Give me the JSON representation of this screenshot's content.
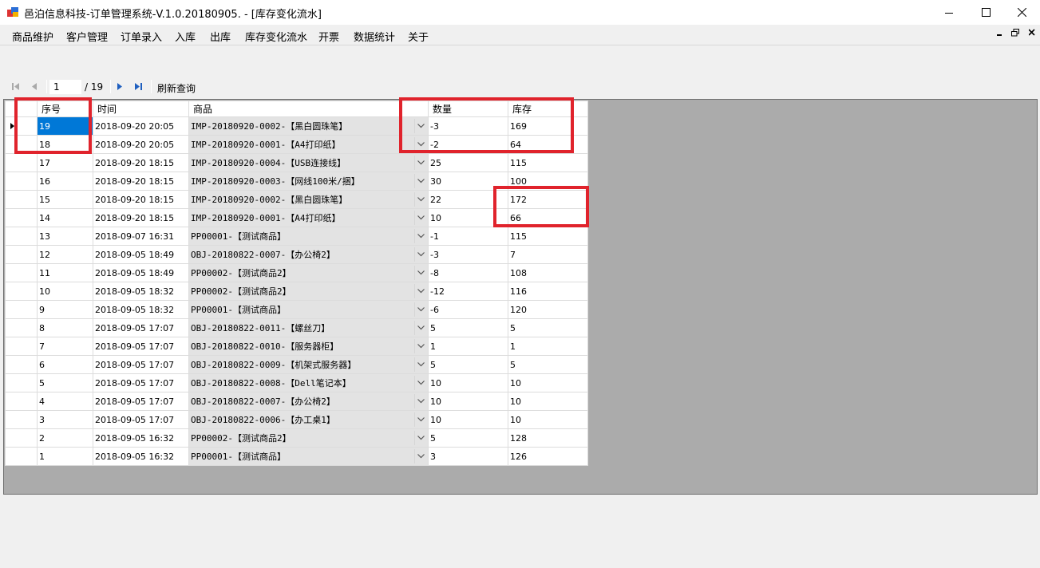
{
  "window": {
    "title": "邑泊信息科技-订单管理系统-V.1.0.20180905. - [库存变化流水]"
  },
  "menu": [
    "商品维护",
    "客户管理",
    "订单录入",
    "入库",
    "出库",
    "库存变化流水",
    "开票",
    "数据统计",
    "关于"
  ],
  "toolbar": {
    "current_page": "1",
    "total_pages": "/ 19",
    "refresh_label": "刷新查询"
  },
  "grid": {
    "columns": {
      "seq": "序号",
      "time": "时间",
      "product": "商品",
      "qty": "数量",
      "stock": "库存"
    },
    "rows": [
      {
        "seq": "19",
        "time": "2018-09-20 20:05",
        "product": "IMP-20180920-0002-【黑白圆珠笔】",
        "qty": "-3",
        "stock": "169"
      },
      {
        "seq": "18",
        "time": "2018-09-20 20:05",
        "product": "IMP-20180920-0001-【A4打印纸】",
        "qty": "-2",
        "stock": "64"
      },
      {
        "seq": "17",
        "time": "2018-09-20 18:15",
        "product": "IMP-20180920-0004-【USB连接线】",
        "qty": "25",
        "stock": "115"
      },
      {
        "seq": "16",
        "time": "2018-09-20 18:15",
        "product": "IMP-20180920-0003-【网线100米/捆】",
        "qty": "30",
        "stock": "100"
      },
      {
        "seq": "15",
        "time": "2018-09-20 18:15",
        "product": "IMP-20180920-0002-【黑白圆珠笔】",
        "qty": "22",
        "stock": "172"
      },
      {
        "seq": "14",
        "time": "2018-09-20 18:15",
        "product": "IMP-20180920-0001-【A4打印纸】",
        "qty": "10",
        "stock": "66"
      },
      {
        "seq": "13",
        "time": "2018-09-07 16:31",
        "product": "PP00001-【测试商品】",
        "qty": "-1",
        "stock": "115"
      },
      {
        "seq": "12",
        "time": "2018-09-05 18:49",
        "product": "OBJ-20180822-0007-【办公椅2】",
        "qty": "-3",
        "stock": "7"
      },
      {
        "seq": "11",
        "time": "2018-09-05 18:49",
        "product": "PP00002-【测试商品2】",
        "qty": "-8",
        "stock": "108"
      },
      {
        "seq": "10",
        "time": "2018-09-05 18:32",
        "product": "PP00002-【测试商品2】",
        "qty": "-12",
        "stock": "116"
      },
      {
        "seq": "9",
        "time": "2018-09-05 18:32",
        "product": "PP00001-【测试商品】",
        "qty": "-6",
        "stock": "120"
      },
      {
        "seq": "8",
        "time": "2018-09-05 17:07",
        "product": "OBJ-20180822-0011-【螺丝刀】",
        "qty": "5",
        "stock": "5"
      },
      {
        "seq": "7",
        "time": "2018-09-05 17:07",
        "product": "OBJ-20180822-0010-【服务器柜】",
        "qty": "1",
        "stock": "1"
      },
      {
        "seq": "6",
        "time": "2018-09-05 17:07",
        "product": "OBJ-20180822-0009-【机架式服务器】",
        "qty": "5",
        "stock": "5"
      },
      {
        "seq": "5",
        "time": "2018-09-05 17:07",
        "product": "OBJ-20180822-0008-【Dell笔记本】",
        "qty": "10",
        "stock": "10"
      },
      {
        "seq": "4",
        "time": "2018-09-05 17:07",
        "product": "OBJ-20180822-0007-【办公椅2】",
        "qty": "10",
        "stock": "10"
      },
      {
        "seq": "3",
        "time": "2018-09-05 17:07",
        "product": "OBJ-20180822-0006-【办工桌1】",
        "qty": "10",
        "stock": "10"
      },
      {
        "seq": "2",
        "time": "2018-09-05 16:32",
        "product": "PP00002-【测试商品2】",
        "qty": "5",
        "stock": "128"
      },
      {
        "seq": "1",
        "time": "2018-09-05 16:32",
        "product": "PP00001-【测试商品】",
        "qty": "3",
        "stock": "126"
      }
    ]
  },
  "colors": {
    "selection": "#0078d7",
    "annotation": "#e0232c",
    "grid_background": "#ababab"
  }
}
